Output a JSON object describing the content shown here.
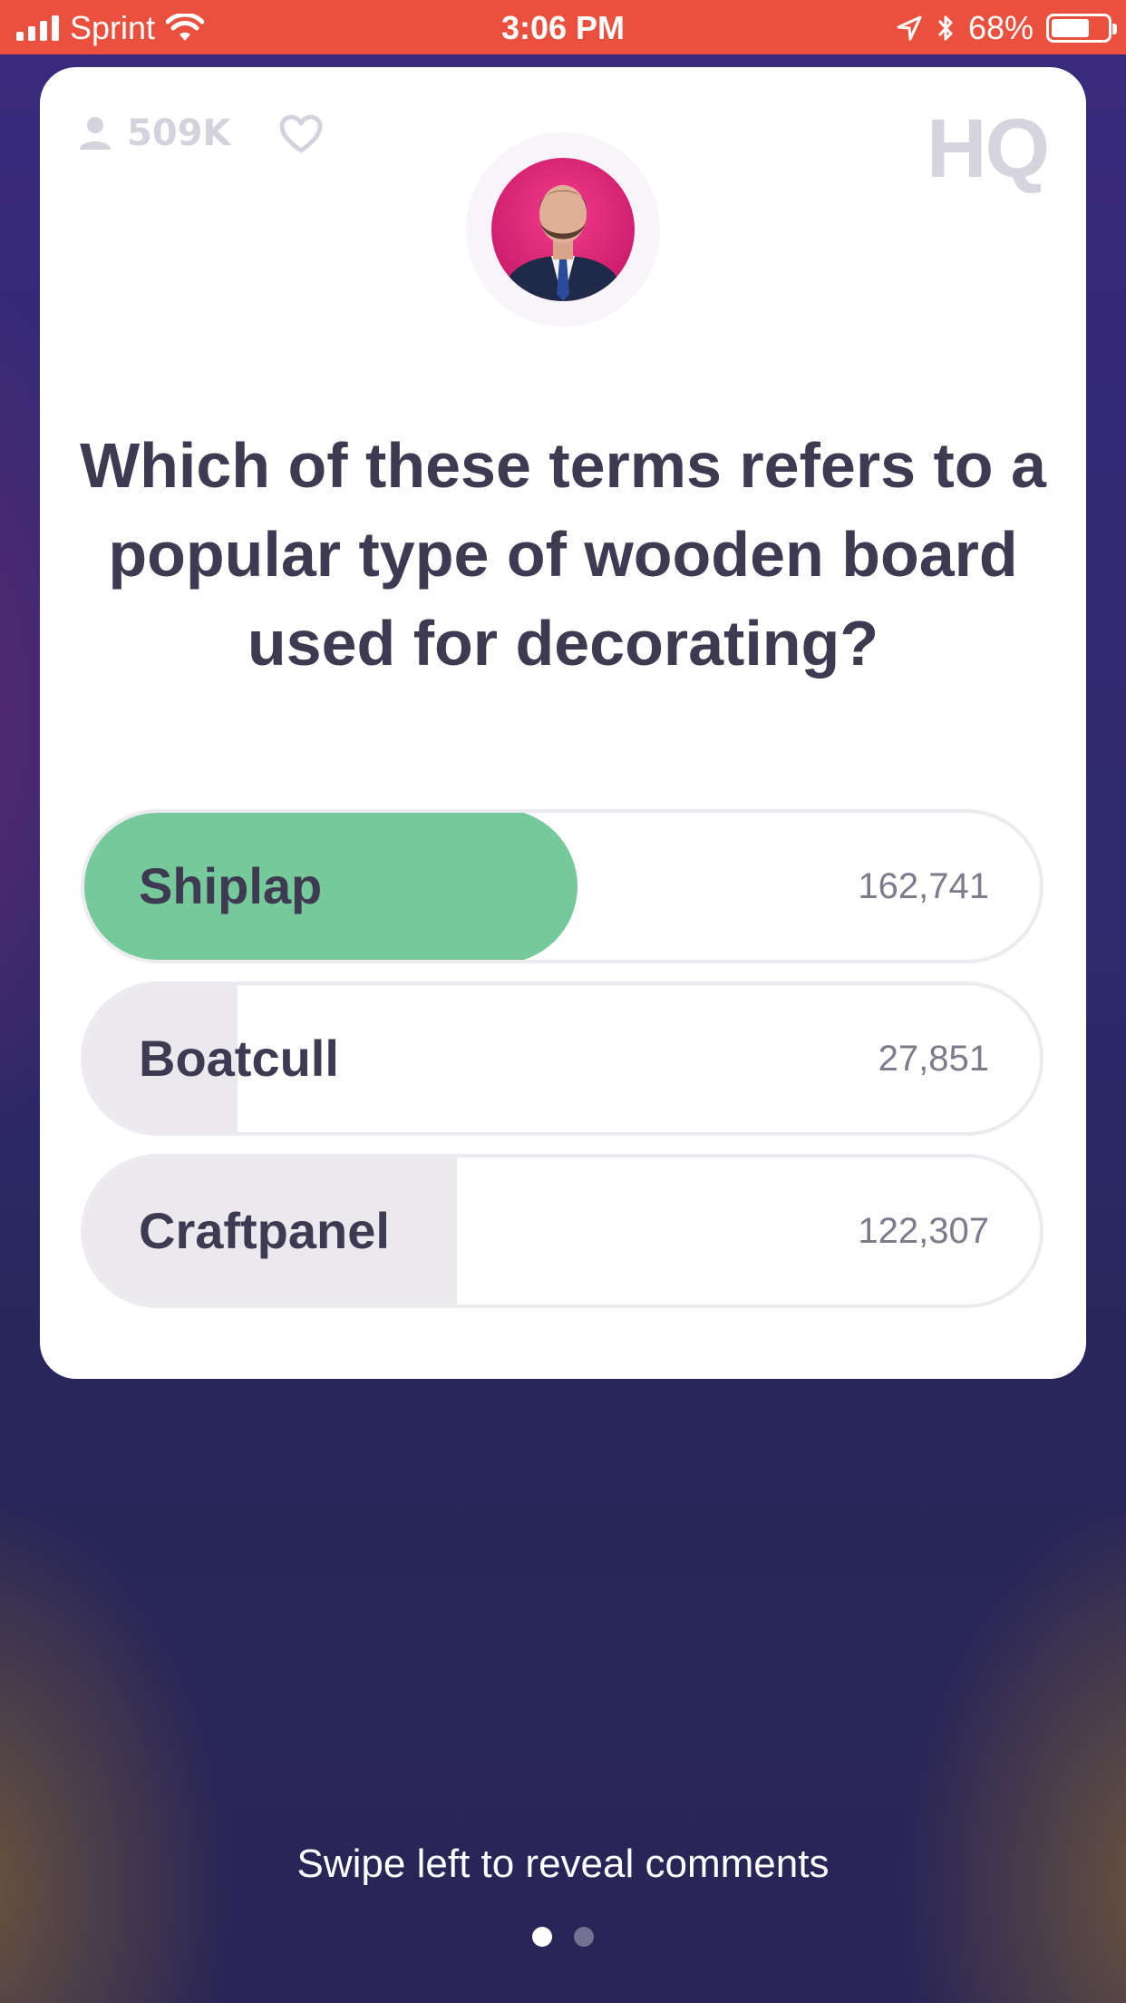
{
  "status_bar": {
    "carrier": "Sprint",
    "time": "3:06 PM",
    "battery": "68%",
    "battery_level": 0.68,
    "icons": [
      "signal-icon",
      "wifi-icon",
      "location-icon",
      "bluetooth-icon",
      "battery-icon"
    ]
  },
  "card": {
    "viewer_count": "509K",
    "logo": "HQ",
    "question": "Which of these terms refers to a popular type of wooden board used for decorating?",
    "answers": [
      {
        "label": "Shiplap",
        "count": "162,741",
        "share": 0.52,
        "correct": true
      },
      {
        "label": "Boatcull",
        "count": "27,851",
        "share": 0.16,
        "correct": false
      },
      {
        "label": "Craftpanel",
        "count": "122,307",
        "share": 0.39,
        "correct": false
      }
    ]
  },
  "footer": {
    "swipe_hint": "Swipe left to reveal comments",
    "page_count": 2,
    "active_page": 1
  },
  "colors": {
    "status_bar": "#e9513e",
    "correct": "#76c99a",
    "text": "#3d3a52"
  }
}
